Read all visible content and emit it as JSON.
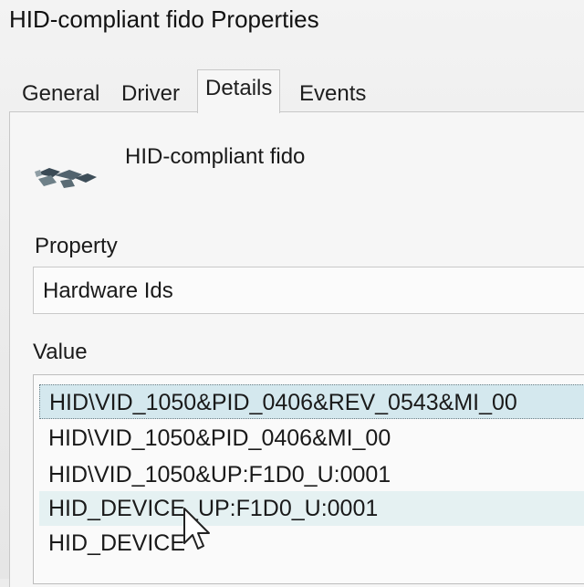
{
  "window": {
    "title": "HID-compliant fido Properties"
  },
  "tabs": [
    {
      "label": "General"
    },
    {
      "label": "Driver"
    },
    {
      "label": "Details"
    },
    {
      "label": "Events"
    }
  ],
  "active_tab": "Details",
  "device": {
    "name": "HID-compliant fido",
    "icon": "hid-device-icon"
  },
  "property": {
    "label": "Property",
    "selected": "Hardware Ids"
  },
  "value": {
    "label": "Value",
    "items": [
      "HID\\VID_1050&PID_0406&REV_0543&MI_00",
      "HID\\VID_1050&PID_0406&MI_00",
      "HID\\VID_1050&UP:F1D0_U:0001",
      "HID_DEVICE_UP:F1D0_U:0001",
      "HID_DEVICE"
    ],
    "selected_index": 0,
    "hover_index": 3
  },
  "colors": {
    "selection": "#d4e8ee",
    "hover": "#e5f1f2",
    "panel": "#f6f6f6"
  }
}
